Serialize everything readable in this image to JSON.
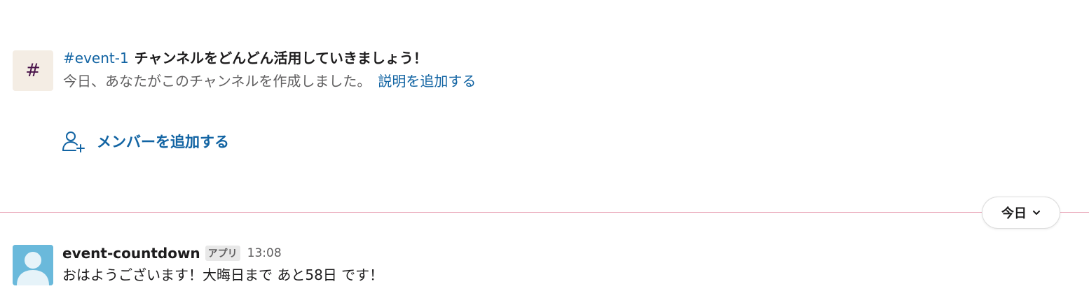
{
  "intro": {
    "avatar_glyph": "#",
    "channel_name": "#event-1",
    "title_suffix": "チャンネルをどんどん活用していきましょう！",
    "subtitle": "今日、あなたがこのチャンネルを作成しました。",
    "add_description_link": "説明を追加する"
  },
  "add_member": {
    "label": "メンバーを追加する",
    "icon": "add-user-icon"
  },
  "divider": {
    "date_label": "今日",
    "color": "#e8a0b4"
  },
  "message": {
    "sender": "event-countdown",
    "badge": "アプリ",
    "time": "13:08",
    "text": "おはようございます！大晦日まで あと58日 です！"
  },
  "colors": {
    "link": "#1264a3",
    "avatar_bg": "#6ab9db",
    "channel_avatar_bg": "#f4ede4"
  }
}
